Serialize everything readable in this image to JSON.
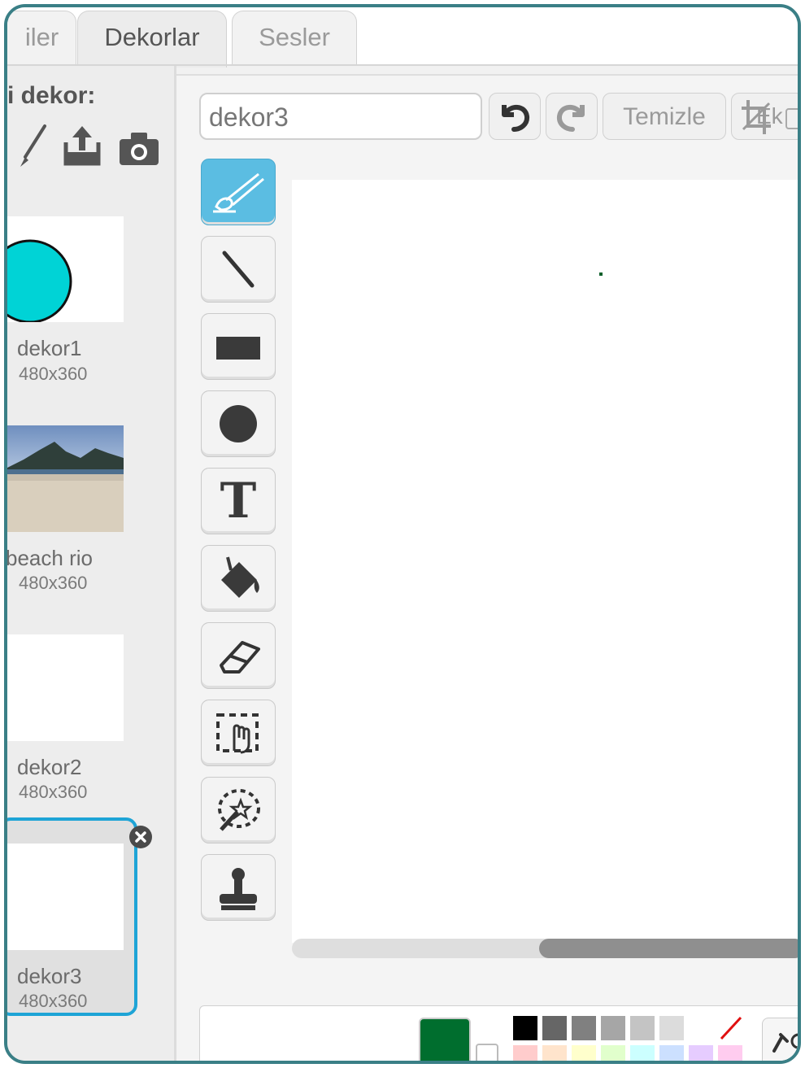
{
  "tabs": [
    {
      "label": "iler",
      "active": false
    },
    {
      "label": "Dekorlar",
      "active": true
    },
    {
      "label": "Sesler",
      "active": false
    }
  ],
  "left_panel": {
    "new_backdrop_label": "i dekor:",
    "tools": [
      "paintbrush-icon",
      "upload-icon",
      "camera-icon"
    ],
    "backdrops": [
      {
        "name": "dekor1",
        "size": "480x360"
      },
      {
        "name": "beach rio",
        "size": "480x360"
      },
      {
        "name": "dekor2",
        "size": "480x360"
      },
      {
        "name": "dekor3",
        "size": "480x360",
        "selected": true
      }
    ]
  },
  "editor": {
    "costume_name": "dekor3",
    "clear_label": "Temizle",
    "add_label": "Ek",
    "tools": [
      "brush-tool",
      "line-tool",
      "rectangle-tool",
      "ellipse-tool",
      "text-tool",
      "fill-tool",
      "eraser-tool",
      "select-tool",
      "magic-select-tool",
      "stamp-tool"
    ],
    "text_tool_glyph": "T",
    "selected_tool": "brush-tool",
    "current_color": "#006e2e",
    "palette_row1": [
      "#000000",
      "#666666",
      "#808080",
      "#a6a6a6",
      "#c4c4c4",
      "#dcdcdc",
      "#ffffff"
    ],
    "palette_row2": [
      "#ffcccc",
      "#ffe4cc",
      "#ffffcc",
      "#e1ffcc",
      "#ccffff",
      "#cce0ff",
      "#e6ccff",
      "#ffccef"
    ]
  }
}
